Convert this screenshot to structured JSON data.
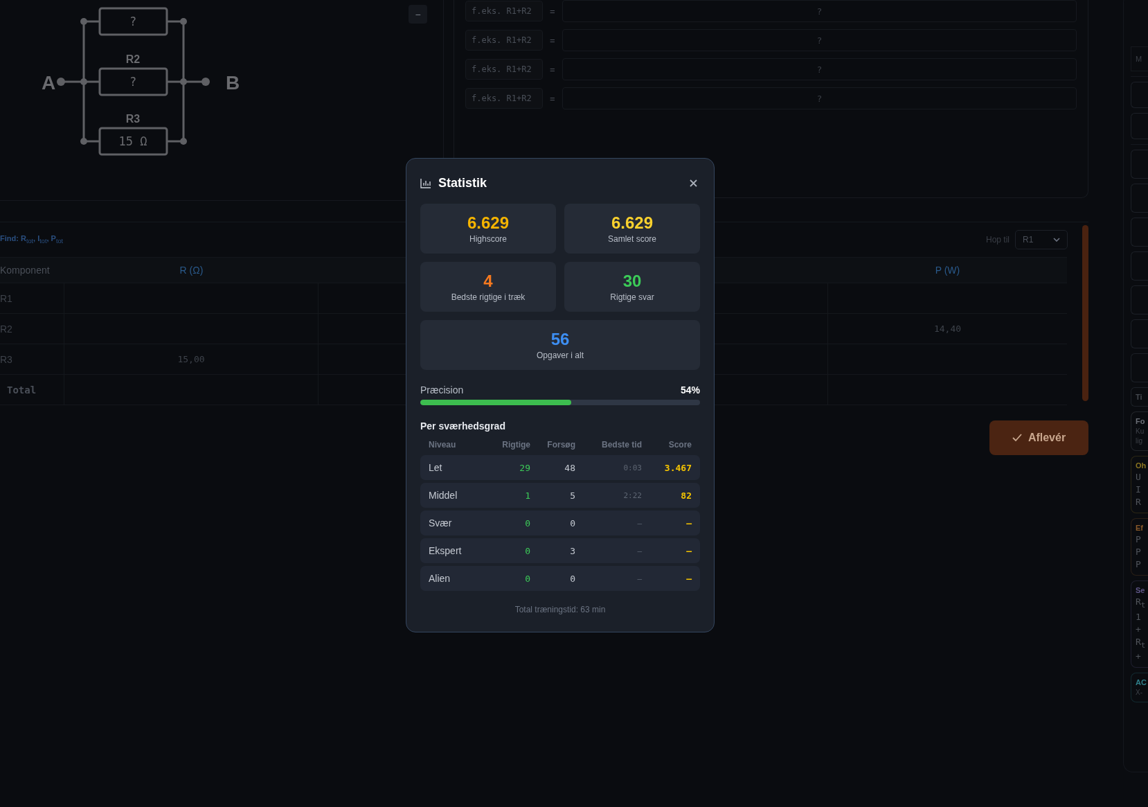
{
  "circuit": {
    "terminals": [
      "A",
      "B"
    ],
    "resistors": [
      {
        "value": "?"
      },
      {
        "label": "R2",
        "value": "?"
      },
      {
        "label": "R3",
        "value": "15 Ω"
      }
    ],
    "collapse_button": "−"
  },
  "formula_rows": [
    {
      "placeholder": "f.eks. R1+R2",
      "equals": "=",
      "result": "?"
    },
    {
      "placeholder": "f.eks. R1+R2",
      "equals": "=",
      "result": "?"
    },
    {
      "placeholder": "f.eks. R1+R2",
      "equals": "=",
      "result": "?"
    },
    {
      "placeholder": "f.eks. R1+R2",
      "equals": "=",
      "result": "?"
    }
  ],
  "table": {
    "find": "Find: R$_{tot}$, I$_{tot}$, P$_{tot}$",
    "jump_label": "Hop til",
    "jump_value": "R1",
    "columns": [
      "Komponent",
      "R (Ω)",
      "P (W)"
    ],
    "rows": [
      {
        "name": "R1",
        "kind": "component"
      },
      {
        "name": "R2",
        "kind": "component",
        "p": "14,40"
      },
      {
        "name": "R3",
        "kind": "component",
        "r": "15,00"
      },
      {
        "name": "Total",
        "kind": "total"
      }
    ]
  },
  "submit_button": "Aflevér",
  "sidebar": {
    "top_label": "M",
    "tab_label": "Ti",
    "cards": [
      {
        "title": "Fo",
        "color": "#6b6f77",
        "lines": [
          "Ku",
          "lig"
        ],
        "kind": "text"
      },
      {
        "title": "Oh",
        "color": "#8a7420",
        "lines": [
          "U",
          "I",
          "R"
        ],
        "kind": "formula"
      },
      {
        "title": "Ef",
        "color": "#8a5a2a",
        "lines": [
          "P",
          "P",
          "P"
        ],
        "kind": "formula"
      },
      {
        "title": "Se",
        "color": "#5e5687",
        "lines": [
          "R$_{t}$",
          "1",
          "+",
          "R$_{t}$",
          "+"
        ],
        "kind": "formula"
      },
      {
        "title": "AC",
        "color": "#2f7f8a",
        "lines": [
          "X-"
        ],
        "kind": "text"
      }
    ]
  },
  "modal": {
    "title": "Statistik",
    "stats": [
      {
        "value": "6.629",
        "label": "Highscore",
        "color": "#f5b400"
      },
      {
        "value": "6.629",
        "label": "Samlet score",
        "color": "#f9d12e"
      },
      {
        "value": "4",
        "label": "Bedste rigtige i træk",
        "color": "#f5791f"
      },
      {
        "value": "30",
        "label": "Rigtige svar",
        "color": "#3ccb58"
      },
      {
        "value": "56",
        "label": "Opgaver i alt",
        "color": "#3d8ef2"
      }
    ],
    "precision": {
      "label": "Præcision",
      "reading": "54%",
      "level": 0.54
    },
    "section_title": "Per sværhedsgrad",
    "columns": [
      "Niveau",
      "Rigtige",
      "Forsøg",
      "Bedste tid",
      "Score"
    ],
    "levels": [
      {
        "name": "Let",
        "correct": "29",
        "attempts": "48",
        "best_time": "0:03",
        "score": "3.467"
      },
      {
        "name": "Middel",
        "correct": "1",
        "attempts": "5",
        "best_time": "2:22",
        "score": "82"
      },
      {
        "name": "Svær",
        "correct": "0",
        "attempts": "0",
        "best_time": "–",
        "score": "–"
      },
      {
        "name": "Ekspert",
        "correct": "0",
        "attempts": "3",
        "best_time": "–",
        "score": "–"
      },
      {
        "name": "Alien",
        "correct": "0",
        "attempts": "0",
        "best_time": "–",
        "score": "–"
      }
    ],
    "footer": "Total træningstid: 63 min"
  }
}
